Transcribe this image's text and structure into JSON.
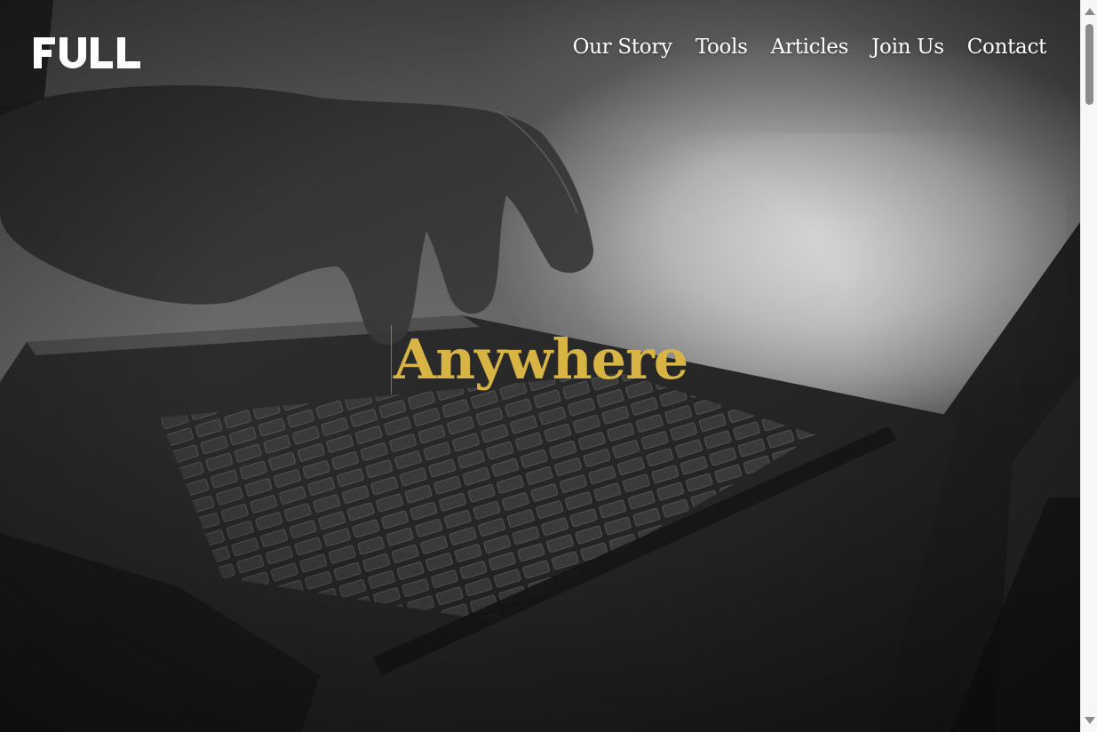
{
  "brand": {
    "logo_text": "FULL",
    "logo_color": "#ffffff"
  },
  "nav": {
    "items": [
      {
        "label": "Our Story"
      },
      {
        "label": "Tools"
      },
      {
        "label": "Articles"
      },
      {
        "label": "Join Us"
      },
      {
        "label": "Contact"
      }
    ]
  },
  "hero": {
    "headline": "Anywhere",
    "headline_color": "#d7b443",
    "background_image": "grayscale-hands-typing-on-laptop"
  },
  "scrollbar": {
    "position_fraction": 0.0
  }
}
